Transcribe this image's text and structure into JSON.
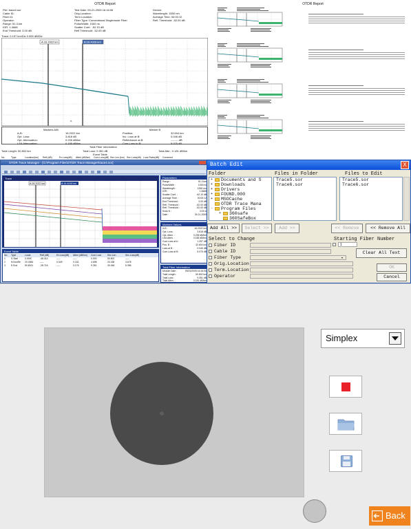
{
  "report_left": {
    "title": "OTDR Report",
    "header_left": [
      "File: trace4.sor",
      "Cable ID:",
      "Fiber ID:",
      "Operator:",
      "Range: 51.3 km",
      "IOR: 1.4668",
      "End Threshold: 3.00 dB"
    ],
    "header_mid": [
      "Test Date: 09-21-2005 16:16:06",
      "Orig.Location :",
      "Term.Location :",
      "Fiber Type: Conventional Singlemode Fiber",
      "PulseWidth: 1000 ns",
      "Scatter Coef.: -52.10 dB",
      "Refl Threshold: -52.00 dB"
    ],
    "header_right": [
      "Device:",
      "",
      "",
      "Wavelength: 1550 nm",
      "Average Time: 00:00:12",
      "Refl. Threshold: -52.00 dB"
    ],
    "trace_label": "Trace: 0.157 km/Div 0.500 dB/Div",
    "marker_a_label": "A:16.2022 km",
    "marker_b_label": "B:16.4028 km",
    "markers_title": "Markers A/B",
    "marker_b_title": "Marker B",
    "markers_rows_left": [
      [
        "A-B:",
        "16.2022 km"
      ],
      [
        "Opt. Loss:",
        "3.818 dB"
      ],
      [
        "Opt. Attenuation:",
        "0.235 dB/km"
      ],
      [
        "LSA Attenuation:",
        "0.185 dB/km"
      ]
    ],
    "markers_rows_right": [
      [
        "Position:",
        "32.604 km"
      ],
      [
        "Inc. Loss at B:",
        "0.046 dB"
      ],
      [
        "Reflectance at B:",
        "-------- dB"
      ],
      [
        "Cum.Loss to B:",
        "5.075 dB"
      ]
    ],
    "summary_title": "Total Fiber Information",
    "summary": [
      "Total Length: 50.802 km",
      "Total Loss: 9.351 dB",
      "Total Atte.: 0.181 dB/km"
    ],
    "event_title": "Event Table",
    "event_headers": [
      "No.",
      "Type",
      "Location(km)",
      "Refl.(dB)",
      "Ev.Loss(dB)",
      "Atten.(dB/km)",
      "Cum.Loss(dB)",
      "Sec.Len.(km)",
      "Sec.Loss(dB)",
      "Loss Ratio(dB)",
      "Comment"
    ],
    "event_rows": [
      [
        "1",
        "Start",
        "0.0000",
        "-48.314",
        "-----",
        "-----",
        "0.000",
        "50.802",
        "-----",
        "-----",
        ""
      ],
      [
        "2",
        "NonRefl.",
        "20.3384",
        "-----",
        "0.049",
        "0.181",
        "4.698",
        "20.338",
        "3.678",
        "4.698",
        ""
      ],
      [
        "3",
        "End",
        "50.8021",
        "-28.716",
        "-----",
        "0.176",
        "9.351",
        "30.464",
        "5.356",
        "4.657",
        ""
      ]
    ]
  },
  "report_right": {
    "title": "OTDR Report",
    "block_count": 4
  },
  "app_window": {
    "title": "OTDR Trace Manager - [G:\\Program Files\\OTDR Trace Manager\\trace4.sor]",
    "menu": [
      "File",
      "Edit",
      "View",
      "Window",
      "Help"
    ],
    "trace_tab": "Trace",
    "marker_a_label": "A:16.2022 km",
    "marker_b_label": "B:16.4028 km",
    "params_title": "Parameters",
    "params": [
      [
        "Range :",
        "51.3 km"
      ],
      [
        "PulseWidth :",
        "1000 ns"
      ],
      [
        "Wavelength :",
        "1550 nm"
      ],
      [
        "IOR :",
        "1.4668"
      ],
      [
        "Scatter Coef. :",
        "-52.10 dB"
      ],
      [
        "Average Time :",
        "00:00:12"
      ],
      [
        "End Threshold :",
        "3.00 dB"
      ],
      [
        "Refl. Threshold :",
        "-52.00 dB"
      ],
      [
        "Refl. Threshold :",
        "-52.00 dB"
      ],
      [
        "Scan N :",
        "0.03 m"
      ],
      [
        "Date :",
        "09-21-2005"
      ]
    ],
    "markers_title": "Markers Values",
    "markers": [
      [
        "A-B :",
        "16.2022 km"
      ],
      [
        "Opt. Loss :",
        "3.818 dB"
      ],
      [
        "Opt. Atten. :",
        "0.235 dB/km"
      ],
      [
        "LSA Atten. :",
        "0.185 dB/km"
      ],
      [
        "Cum.Loss at A :",
        "1.257 dB"
      ],
      [
        "Pos. B :",
        "32.604 km"
      ],
      [
        "Loss at B :",
        "0.046 dB"
      ],
      [
        "Cum.Loss at B :",
        "5.075 dB"
      ]
    ],
    "event_title": "Event Table",
    "event_headers": [
      "No.",
      "Type",
      "Locat.",
      "Refl.(dB)",
      "Ev.Loss(dB)",
      "Atten.(dB/km)",
      "Cum.Loss",
      "Sec.Len.",
      "Sec.Loss(dB)"
    ],
    "event_rows": [
      [
        "1",
        "S.Start",
        "0.0000",
        "-48.314",
        "-----",
        "-----",
        "0.000",
        "50.802",
        "-----"
      ],
      [
        "2",
        "N.NonRe",
        "20.3384",
        "-----",
        "0.049",
        "0.181",
        "4.698",
        "20.338",
        "3.678"
      ],
      [
        "3",
        "E.End",
        "50.8021",
        "-28.716",
        "-----",
        "0.176",
        "9.351",
        "30.464",
        "5.356"
      ]
    ],
    "summary_title": "Total Fiber Information",
    "summary": [
      [
        "Module Date :",
        "09/21/2005 16:16:06"
      ],
      [
        "Total Length :",
        "50.802 km"
      ],
      [
        "Total Loss :",
        "9.351 dB"
      ],
      [
        "Total Atten. :",
        "0.181 dB/km"
      ],
      [
        "Event Number :",
        "3"
      ]
    ]
  },
  "batch_dialog": {
    "title": "Batch Edit",
    "close": "X",
    "col_folder": "Folder",
    "col_files_in_folder": "Files in Folder",
    "col_files_to_edit": "Files to Edit",
    "tree": [
      {
        "sign": "+",
        "label": "Documents and S"
      },
      {
        "sign": "+",
        "label": "Downloads"
      },
      {
        "sign": "+",
        "label": "Drivers"
      },
      {
        "sign": "+",
        "label": "FOUND.000"
      },
      {
        "sign": "+",
        "label": "MSOCache"
      },
      {
        "sign": "",
        "label": "OTDR Trace Mana"
      },
      {
        "sign": "-",
        "label": "Program Files"
      },
      {
        "sign": "+",
        "label": "360safe"
      },
      {
        "sign": "",
        "label": "360SafeBox"
      }
    ],
    "files_in_folder": [
      "Trace5.sor",
      "Trace6.sor"
    ],
    "files_to_edit": [
      "Trace5.sor",
      "Trace6.sor"
    ],
    "btn_add_all": "Add All >>",
    "btn_select": "Select >>",
    "btn_add": "Add >>",
    "btn_remove": "<< Remove",
    "btn_remove_all": "<< Remove All",
    "select_to_change": "Select to Change",
    "starting_fiber_number": "Starting Fiber Number",
    "starting_fiber_value": "1",
    "fields": [
      "Fiber ID",
      "Cable ID",
      "Fiber Type",
      "Orig.Location",
      "Term.Location",
      "Operator"
    ],
    "btn_clear_all": "Clear All Text",
    "btn_ok": "OK",
    "btn_cancel": "Cancel"
  },
  "scope_panel": {
    "mode_select_value": "Simplex",
    "record_icon": "record-icon",
    "folder_icon": "folder-icon",
    "save_icon": "floppy-save-icon",
    "back_label": "Back",
    "back_icon": "back-arrow-icon",
    "colors": {
      "accent_orange": "#f0831d",
      "record_red": "#e8212b",
      "folder_blue": "#8fb0d8",
      "dialog_title_blue": "#0a4fd9"
    }
  }
}
